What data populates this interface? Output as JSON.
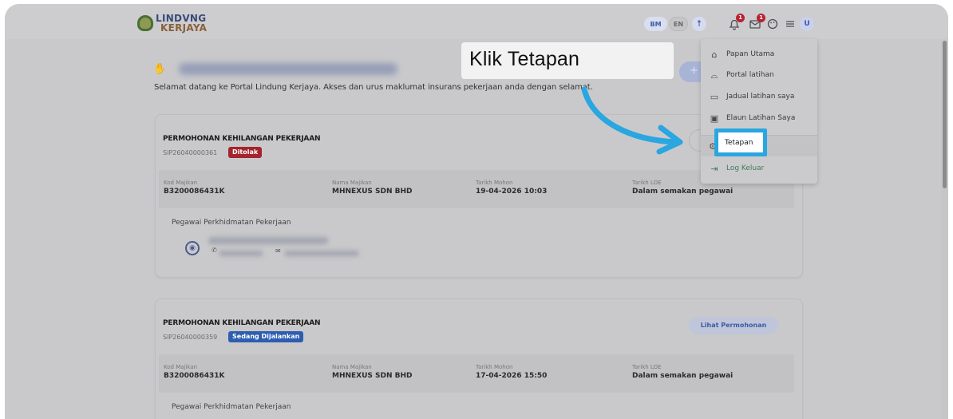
{
  "header": {
    "logo_line1": "LINDVNG",
    "logo_line2": "KERJAYA",
    "lang_bm": "BM",
    "lang_en": "EN",
    "accessibility_icon": "accessibility-icon",
    "notif_badge": "1",
    "mail_badge": "1",
    "avatar_initial": "U"
  },
  "main": {
    "welcome_text": "Selamat datang ke Portal Lindung Kerjaya. Akses dan urus maklumat insurans pekerjaan anda dengan selamat."
  },
  "cards": [
    {
      "title": "PERMOHONAN KEHILANGAN PEKERJAAN",
      "ref": "SIP26040000361",
      "status": "Ditolak",
      "status_color": "#a5232c",
      "fields": {
        "kod_majikan_label": "Kod Majikan",
        "kod_majikan": "B3200086431K",
        "nama_majikan_label": "Nama Majikan",
        "nama_majikan": "MHNEXUS SDN BHD",
        "tarikh_mohon_label": "Tarikh Mohon",
        "tarikh_mohon": "19-04-2026 10:03",
        "tarikh_loe_label": "Tarikh LOE",
        "tarikh_loe": "Dalam semakan pegawai"
      },
      "officer_label": "Pegawai Perkhidmatan Pekerjaan"
    },
    {
      "title": "PERMOHONAN KEHILANGAN PEKERJAAN",
      "ref": "SIP26040000359",
      "status": "Sedang Dijalankan",
      "status_color": "#2e5db0",
      "view_button": "Lihat Permohonan",
      "fields": {
        "kod_majikan_label": "Kod Majikan",
        "kod_majikan": "B3200086431K",
        "nama_majikan_label": "Nama Majikan",
        "nama_majikan": "MHNEXUS SDN BHD",
        "tarikh_mohon_label": "Tarikh Mohon",
        "tarikh_mohon": "17-04-2026 15:50",
        "tarikh_loe_label": "Tarikh LOE",
        "tarikh_loe": "Dalam semakan pegawai"
      },
      "officer_label": "Pegawai Perkhidmatan Pekerjaan"
    }
  ],
  "menu": {
    "items": [
      {
        "icon": "home-icon",
        "label": "Papan Utama"
      },
      {
        "icon": "graduation-cap-icon",
        "label": "Portal latihan"
      },
      {
        "icon": "calendar-icon",
        "label": "Jadual latihan saya"
      },
      {
        "icon": "wallet-icon",
        "label": "Elaun Latihan Saya"
      },
      {
        "icon": "gear-icon",
        "label": "Tetapan"
      },
      {
        "icon": "logout-icon",
        "label": "Log Keluar"
      }
    ]
  },
  "annotation": {
    "callout_text": "Klik Tetapan",
    "highlight_label": "Tetapan",
    "accent_color": "#2aa6e0"
  }
}
